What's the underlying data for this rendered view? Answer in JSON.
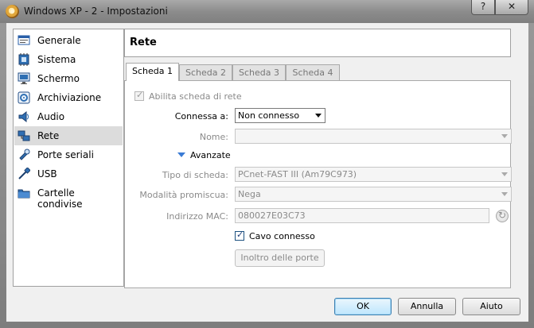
{
  "window": {
    "title": "Windows XP - 2 - Impostazioni",
    "help_glyph": "?",
    "close_glyph": "✕"
  },
  "sidebar": {
    "items": [
      {
        "label": "Generale",
        "icon": "general-icon"
      },
      {
        "label": "Sistema",
        "icon": "system-chip-icon"
      },
      {
        "label": "Schermo",
        "icon": "monitor-icon"
      },
      {
        "label": "Archiviazione",
        "icon": "storage-disk-icon"
      },
      {
        "label": "Audio",
        "icon": "speaker-icon"
      },
      {
        "label": "Rete",
        "icon": "network-icon",
        "selected": true
      },
      {
        "label": "Porte seriali",
        "icon": "serial-port-icon"
      },
      {
        "label": "USB",
        "icon": "usb-icon"
      },
      {
        "label": "Cartelle condivise",
        "icon": "shared-folder-icon"
      }
    ]
  },
  "header": {
    "title": "Rete"
  },
  "tabs": [
    {
      "label": "Scheda 1",
      "active": true
    },
    {
      "label": "Scheda 2"
    },
    {
      "label": "Scheda 3"
    },
    {
      "label": "Scheda 4"
    }
  ],
  "form": {
    "enable_adapter": {
      "label": "Abilita scheda di rete",
      "checked": true,
      "enabled": false
    },
    "attached_to": {
      "label": "Connessa a:",
      "value": "Non connesso"
    },
    "name": {
      "label": "Nome:",
      "value": ""
    },
    "advanced": {
      "label": "Avanzate"
    },
    "adapter_type": {
      "label": "Tipo di scheda:",
      "value": "PCnet-FAST III (Am79C973)"
    },
    "promiscuous": {
      "label": "Modalità promiscua:",
      "value": "Nega"
    },
    "mac": {
      "label": "Indirizzo MAC:",
      "value": "080027E03C73"
    },
    "cable": {
      "label": "Cavo connesso",
      "checked": true
    },
    "port_forwarding": {
      "label": "Inoltro delle porte"
    }
  },
  "buttons": {
    "ok": "OK",
    "cancel": "Annulla",
    "help": "Aiuto"
  },
  "colors": {
    "accent": "#3a7bd5",
    "selection": "#dcdcdc"
  }
}
